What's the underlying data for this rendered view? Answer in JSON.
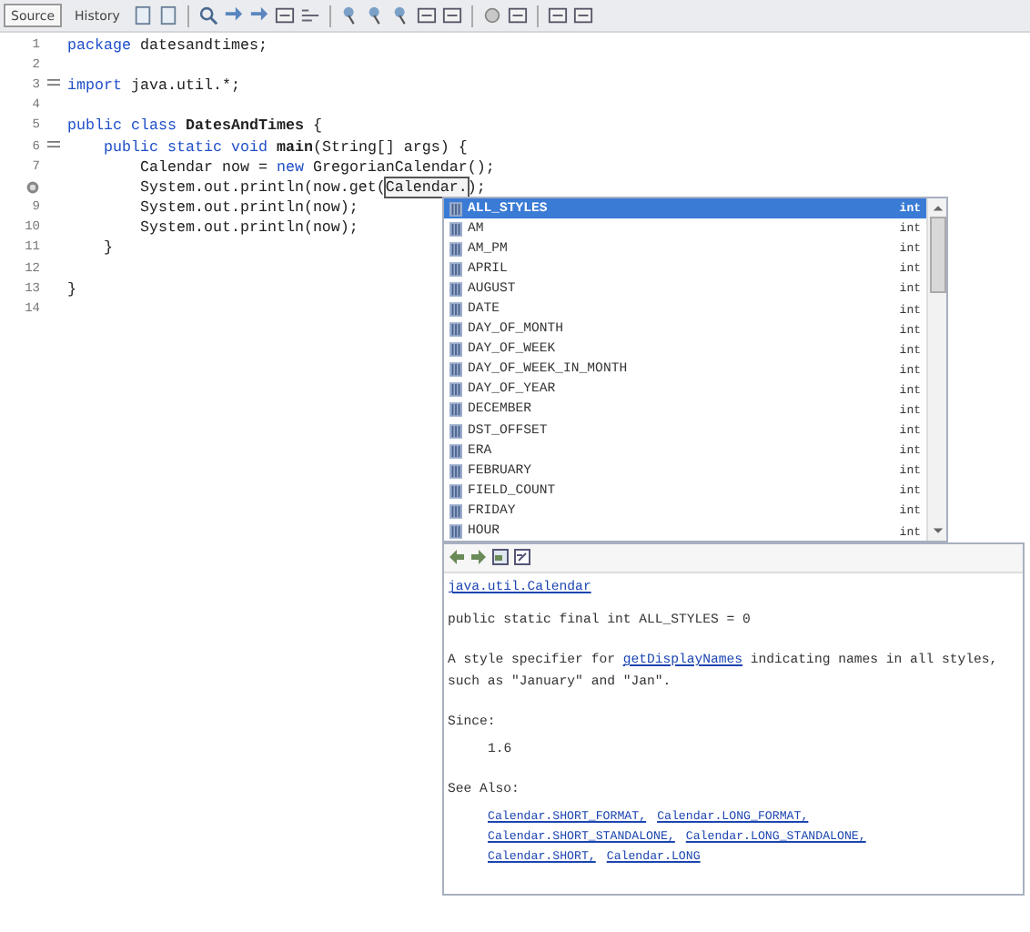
{
  "tabs": [
    {
      "label": "Source",
      "selected": true
    },
    {
      "label": "History",
      "selected": false
    }
  ],
  "editor": {
    "lines": [
      {
        "number": "1",
        "fold": false,
        "hint": false,
        "segments": [
          {
            "text": "package",
            "kind": "keyword"
          },
          {
            "text": " datesandtimes;",
            "kind": "plain"
          }
        ]
      },
      {
        "number": "2",
        "fold": false,
        "hint": false
      },
      {
        "number": "3",
        "fold": true,
        "hint": false,
        "segments": [
          {
            "text": "import",
            "kind": "keyword"
          },
          {
            "text": " java.util.*;",
            "kind": "plain"
          }
        ]
      },
      {
        "number": "4",
        "fold": false,
        "hint": false
      },
      {
        "number": "5",
        "fold": false,
        "hint": false,
        "segments": [
          {
            "text": "public class ",
            "kind": "keyword"
          },
          {
            "text": "DatesAndTimes",
            "kind": "bold"
          },
          {
            "text": " {",
            "kind": "plain"
          }
        ]
      },
      {
        "number": "6",
        "fold": true,
        "hint": false,
        "segments": [
          {
            "text": "    public static void ",
            "kind": "keyword"
          },
          {
            "text": "main",
            "kind": "bold"
          },
          {
            "text": "(String[] args) {",
            "kind": "plain"
          }
        ]
      },
      {
        "number": "7",
        "fold": false,
        "hint": false,
        "segments": [
          {
            "text": "        Calendar now = ",
            "kind": "plain"
          },
          {
            "text": "new",
            "kind": "keyword"
          },
          {
            "text": " GregorianCalendar();",
            "kind": "plain"
          }
        ]
      },
      {
        "fold": false,
        "hint": true,
        "segments": [
          {
            "text": "        System.out.println(now.get(",
            "kind": "plain"
          },
          {
            "text": "Calendar.",
            "kind": "field"
          },
          {
            "text": ");",
            "kind": "plain"
          }
        ]
      },
      {
        "number": "9",
        "fold": false,
        "hint": false,
        "segments": [
          {
            "text": "        System.out.println(now);",
            "kind": "plain"
          }
        ]
      },
      {
        "number": "10",
        "fold": false,
        "hint": false,
        "segments": [
          {
            "text": "        System.out.println(now);",
            "kind": "plain"
          }
        ]
      },
      {
        "number": "11",
        "fold": false,
        "hint": false,
        "segments": [
          {
            "text": "    }",
            "kind": "plain"
          }
        ]
      },
      {
        "number": "12",
        "fold": false,
        "hint": false
      },
      {
        "number": "13",
        "fold": false,
        "hint": false,
        "segments": [
          {
            "text": "}",
            "kind": "plain"
          }
        ]
      },
      {
        "number": "14",
        "fold": false,
        "hint": false
      }
    ]
  },
  "completion": {
    "items": [
      {
        "name": "ALL_STYLES",
        "type": "int",
        "selected": true
      },
      {
        "name": "AM",
        "type": "int",
        "selected": false
      },
      {
        "name": "AM_PM",
        "type": "int",
        "selected": false
      },
      {
        "name": "APRIL",
        "type": "int",
        "selected": false
      },
      {
        "name": "AUGUST",
        "type": "int",
        "selected": false
      },
      {
        "name": "DATE",
        "type": "int",
        "selected": false
      },
      {
        "name": "DAY_OF_MONTH",
        "type": "int",
        "selected": false
      },
      {
        "name": "DAY_OF_WEEK",
        "type": "int",
        "selected": false
      },
      {
        "name": "DAY_OF_WEEK_IN_MONTH",
        "type": "int",
        "selected": false
      },
      {
        "name": "DAY_OF_YEAR",
        "type": "int",
        "selected": false
      },
      {
        "name": "DECEMBER",
        "type": "int",
        "selected": false
      },
      {
        "name": "DST_OFFSET",
        "type": "int",
        "selected": false
      },
      {
        "name": "ERA",
        "type": "int",
        "selected": false
      },
      {
        "name": "FEBRUARY",
        "type": "int",
        "selected": false
      },
      {
        "name": "FIELD_COUNT",
        "type": "int",
        "selected": false
      },
      {
        "name": "FRIDAY",
        "type": "int",
        "selected": false
      },
      {
        "name": "HOUR",
        "type": "int",
        "selected": false
      }
    ]
  },
  "javadoc": {
    "class_link": "java.util.Calendar",
    "signature": "public static final int ALL_STYLES = 0",
    "description": "A style specifier for ",
    "description_link": "getDisplayNames",
    "description_rest": " indicating names in all styles, such as \"January\" and \"Jan\".",
    "since_label": "Since:",
    "since": "1.6",
    "see_also_label": "See Also:",
    "see_also": [
      "Calendar.SHORT_FORMAT,",
      "Calendar.LONG_FORMAT,",
      "Calendar.SHORT_STANDALONE,",
      "Calendar.LONG_STANDALONE,",
      "Calendar.SHORT,",
      "Calendar.LONG"
    ]
  }
}
